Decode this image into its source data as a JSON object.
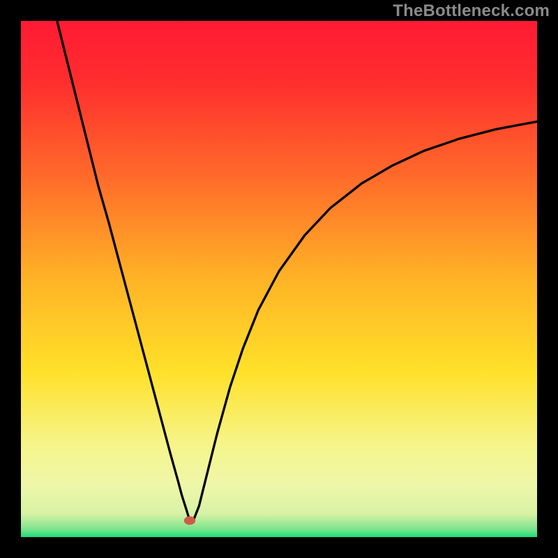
{
  "watermark": "TheBottleneck.com",
  "chart_data": {
    "type": "line",
    "title": "",
    "xlabel": "",
    "ylabel": "",
    "xlim": [
      0,
      100
    ],
    "ylim": [
      0,
      100
    ],
    "grid": false,
    "legend": false,
    "gradient_stops": [
      {
        "offset": 0.0,
        "color": "#ff1a33"
      },
      {
        "offset": 0.12,
        "color": "#ff2e2e"
      },
      {
        "offset": 0.3,
        "color": "#ff6a2a"
      },
      {
        "offset": 0.5,
        "color": "#ffb326"
      },
      {
        "offset": 0.68,
        "color": "#ffe129"
      },
      {
        "offset": 0.82,
        "color": "#f6f58a"
      },
      {
        "offset": 0.9,
        "color": "#eef7a9"
      },
      {
        "offset": 0.955,
        "color": "#d8f2a4"
      },
      {
        "offset": 0.985,
        "color": "#7ce48e"
      },
      {
        "offset": 1.0,
        "color": "#18df78"
      }
    ],
    "marker": {
      "x": 32.7,
      "y": 3.2,
      "color": "#cf5a4a",
      "r": 1.1
    },
    "series": [
      {
        "name": "curve",
        "color": "#000000",
        "x": [
          7.0,
          9.0,
          11.0,
          13.0,
          15.0,
          17.0,
          19.0,
          21.0,
          23.0,
          25.0,
          27.0,
          29.0,
          30.4,
          31.2,
          32.0,
          32.7,
          33.4,
          34.5,
          36.0,
          38.0,
          40.5,
          43.0,
          46.0,
          50.0,
          55.0,
          60.0,
          66.0,
          72.0,
          78.0,
          85.0,
          92.0,
          100.0
        ],
        "y": [
          100.0,
          92.0,
          84.0,
          76.0,
          68.0,
          61.0,
          53.5,
          46.0,
          38.5,
          31.0,
          23.5,
          16.0,
          11.0,
          8.0,
          5.5,
          3.2,
          3.2,
          6.0,
          12.0,
          20.0,
          29.0,
          36.5,
          44.0,
          51.5,
          58.5,
          63.8,
          68.5,
          72.0,
          74.8,
          77.2,
          79.0,
          80.5
        ]
      }
    ]
  }
}
